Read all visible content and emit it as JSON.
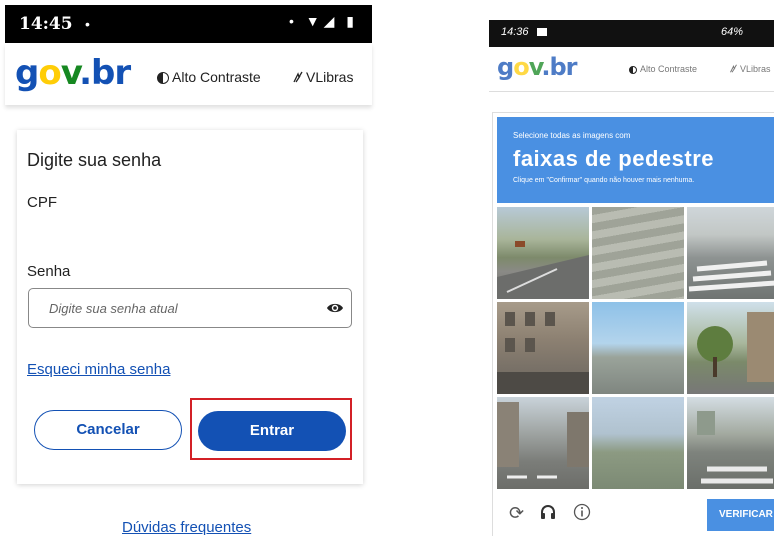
{
  "left": {
    "status": {
      "time": "14:45",
      "dot": "•",
      "icons": "• ▼◢ ▮"
    },
    "header": {
      "logo": {
        "g": "g",
        "o": "o",
        "v": "v",
        "br": ".br"
      },
      "contrast": "Alto Contraste",
      "vlibras": "VLibras"
    },
    "form": {
      "title": "Digite sua senha",
      "cpf_label": "CPF",
      "senha_label": "Senha",
      "senha_placeholder": "Digite sua senha atual",
      "forgot": "Esqueci minha senha",
      "cancel": "Cancelar",
      "submit": "Entrar"
    },
    "faq": "Dúvidas frequentes"
  },
  "right": {
    "status": {
      "time": "14:36",
      "percent": "64%"
    },
    "header": {
      "logo": {
        "g": "g",
        "o": "o",
        "v": "v",
        "br": ".br"
      },
      "contrast": "Alto Contraste",
      "vlibras": "VLibras"
    },
    "captcha": {
      "line1": "Selecione todas as imagens com",
      "line2": "faixas de pedestre",
      "line3": "Clique em \"Confirmar\" quando não houver mais nenhuma.",
      "verify": "VERIFICAR",
      "tiles": [
        "road-scene",
        "stairs-scene",
        "crosswalk-scene",
        "building-scene",
        "plaza-scene",
        "street-tree-scene",
        "city-street-scene",
        "avenue-scene",
        "road-crosswalk-scene"
      ]
    }
  },
  "colors": {
    "brand_blue": "#1351b4",
    "highlight_red": "#d32026",
    "captcha_blue": "#4a90e2"
  },
  "icons": [
    "contrast-icon",
    "vlibras-icon",
    "eye-icon",
    "refresh-icon",
    "headphones-icon",
    "info-icon"
  ]
}
